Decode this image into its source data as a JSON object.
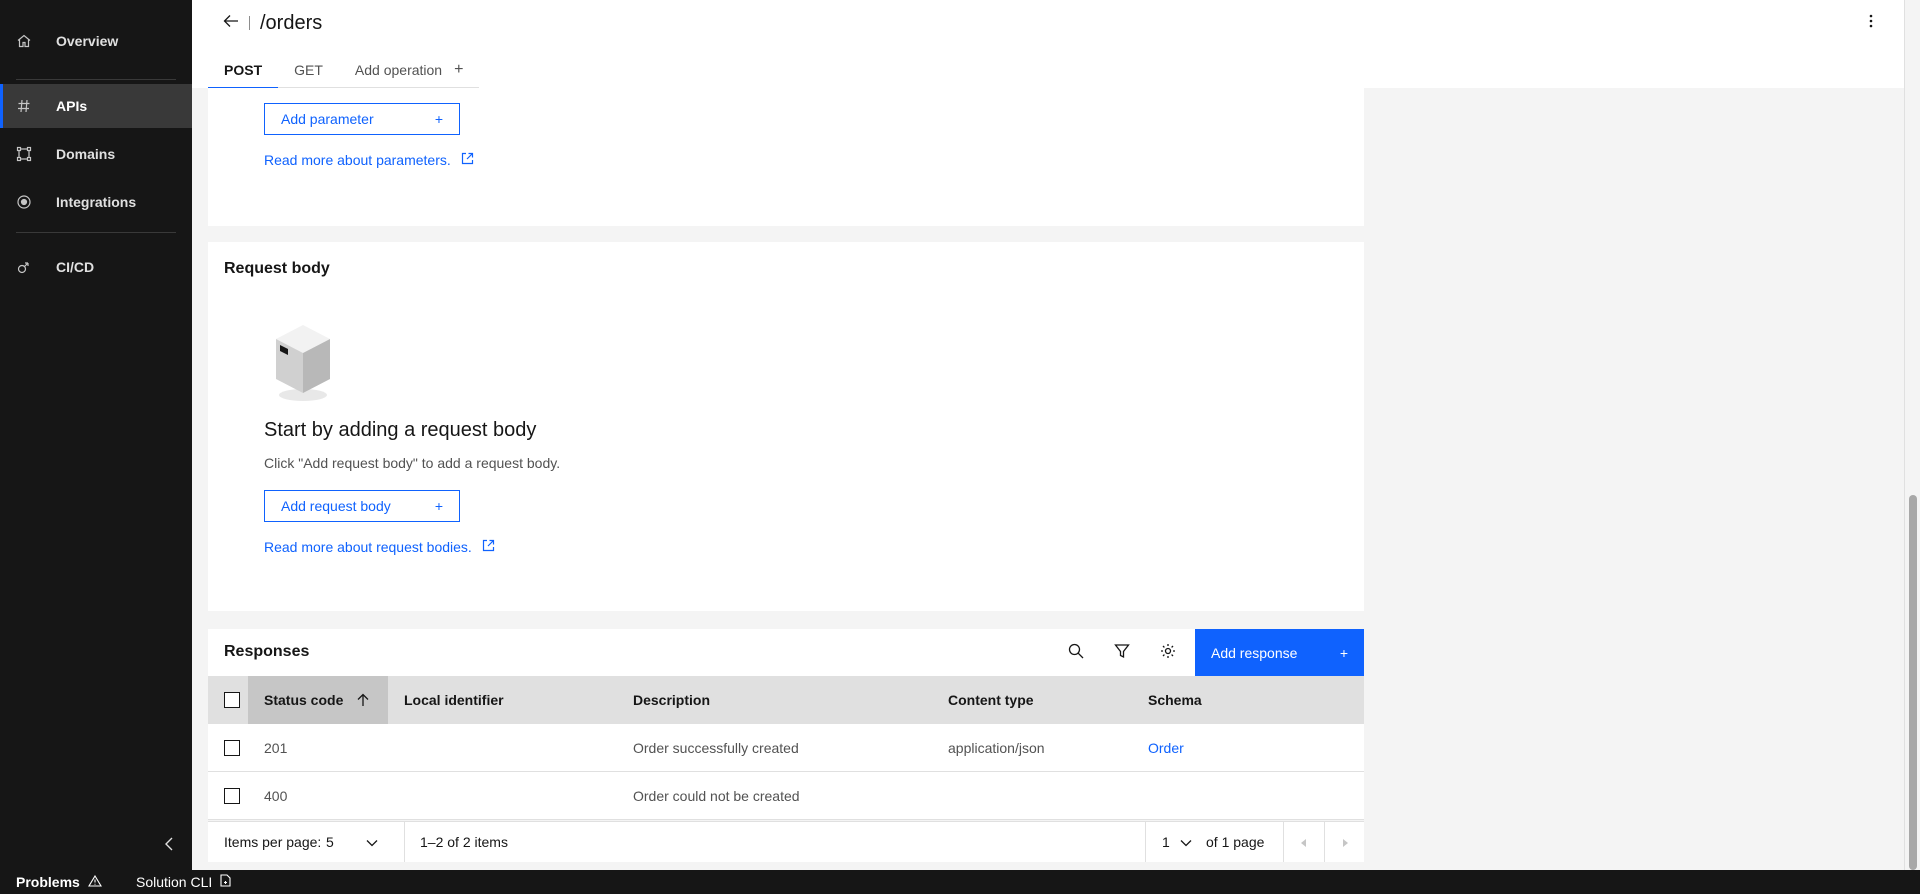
{
  "sidebar": {
    "items": [
      {
        "label": "Overview",
        "icon": "home-icon"
      },
      {
        "label": "APIs",
        "icon": "hash-icon",
        "active": true
      },
      {
        "label": "Domains",
        "icon": "domain-icon"
      },
      {
        "label": "Integrations",
        "icon": "integration-icon"
      },
      {
        "label": "CI/CD",
        "icon": "cicd-icon"
      }
    ]
  },
  "header": {
    "title": "/orders",
    "tabs": [
      {
        "label": "POST"
      },
      {
        "label": "GET"
      },
      {
        "label": "Add operation"
      }
    ]
  },
  "parameters": {
    "add_button": "Add parameter",
    "read_more": "Read more about parameters."
  },
  "request_body": {
    "title": "Request body",
    "empty_title": "Start by adding a request body",
    "empty_desc": "Click \"Add request body\" to add a request body.",
    "add_button": "Add request body",
    "read_more": "Read more about request bodies."
  },
  "responses": {
    "title": "Responses",
    "add_button": "Add response",
    "columns": [
      "Status code",
      "Local identifier",
      "Description",
      "Content type",
      "Schema"
    ],
    "rows": [
      {
        "status": "201",
        "identifier": "",
        "description": "Order successfully created",
        "content_type": "application/json",
        "schema": "Order"
      },
      {
        "status": "400",
        "identifier": "",
        "description": "Order could not be created",
        "content_type": "",
        "schema": ""
      }
    ],
    "pagination": {
      "items_per_page_label": "Items per page:",
      "items_per_page": "5",
      "range": "1–2 of 2 items",
      "page": "1",
      "of_pages": "of 1 page"
    }
  },
  "statusbar": {
    "problems": "Problems",
    "solution_cli": "Solution CLI"
  },
  "colors": {
    "accent": "#0f62fe",
    "sidebar_bg": "#161616"
  }
}
